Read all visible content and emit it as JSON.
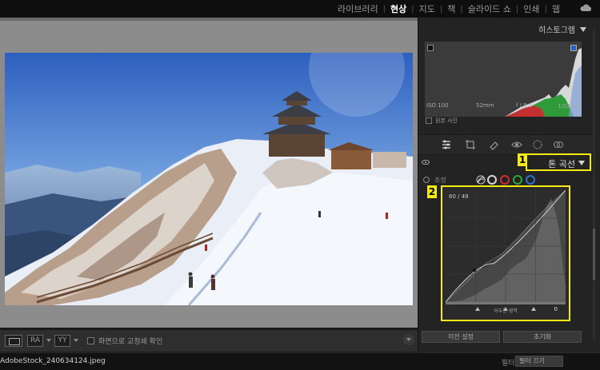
{
  "modules": [
    "라이브러리",
    "현상",
    "지도",
    "책",
    "슬라이드 쇼",
    "인쇄",
    "웹"
  ],
  "active_module": "현상",
  "histogram": {
    "title": "히스토그램",
    "iso": "ISO 100",
    "focal": "52mm",
    "aperture": "f / 8.0",
    "shutter": "1/320초",
    "original_photo_label": "원본 사진"
  },
  "tone_curve": {
    "title": "톤 곡선",
    "adjust_label": "조정",
    "readout": "60 / 49",
    "region_label": "어두운 영역",
    "output_value": "0",
    "channel_colors": [
      "#d8d8d8",
      "#d22b2b",
      "#2faa3a",
      "#2f6fd6"
    ]
  },
  "annotations": {
    "badge1": "1",
    "badge2": "2"
  },
  "toolbar": {
    "ra_label": "RA",
    "yy_label": "YY",
    "softproof_label": "화면으로 교정쇄 확인"
  },
  "buttons": {
    "previous": "이전 설정",
    "reset": "초기화"
  },
  "filmstrip": {
    "filename": "AdobeStock_240634124.jpeg",
    "filter_label": "필터:",
    "filter_value": "필터 끄기"
  },
  "colors": {
    "highlight": "#f6ea14"
  }
}
